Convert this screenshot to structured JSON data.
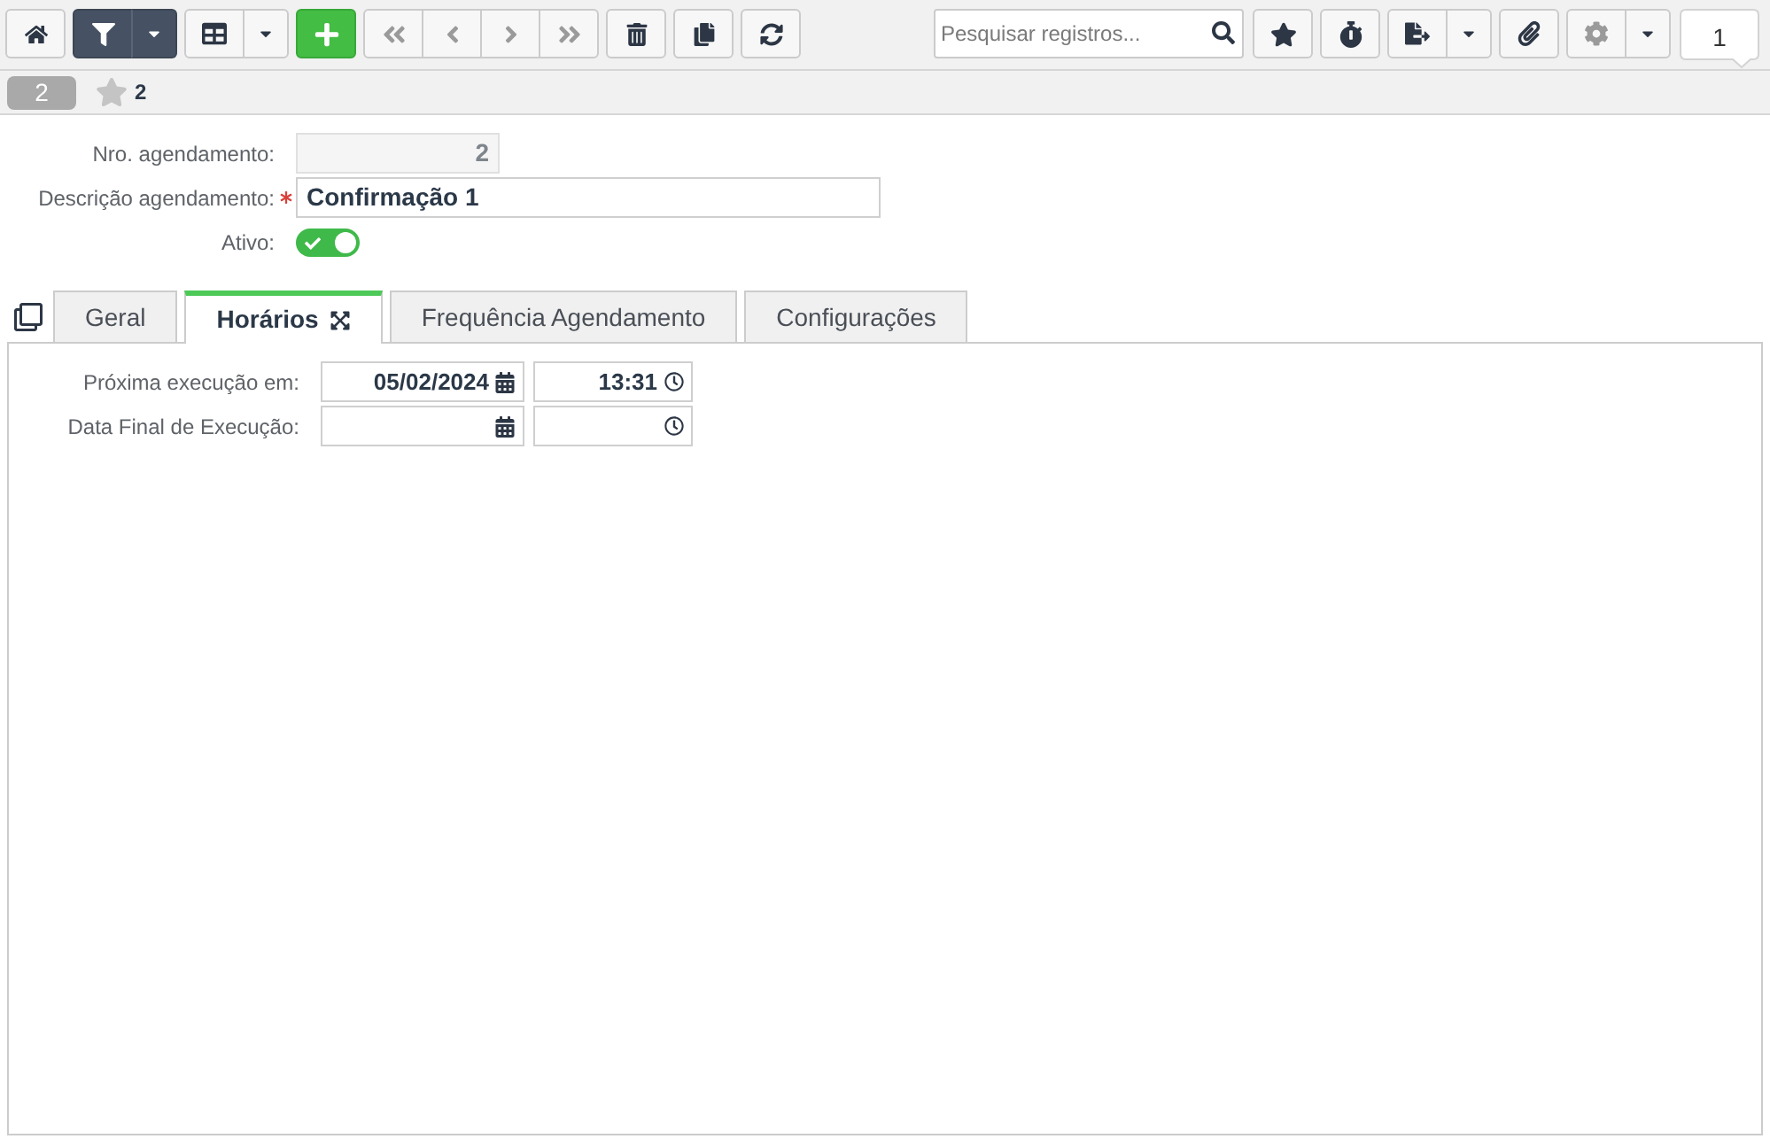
{
  "toolbar": {
    "left": [
      [
        {
          "kind": "home",
          "active": false,
          "disabled": false,
          "dropdown": false
        }
      ],
      [
        {
          "kind": "filter",
          "active": true,
          "disabled": false,
          "dropdown": true
        }
      ],
      [
        {
          "kind": "grid",
          "active": false,
          "disabled": false,
          "dropdown": true
        }
      ],
      [
        {
          "kind": "add",
          "active": false,
          "disabled": false,
          "dropdown": false
        }
      ],
      [
        {
          "kind": "first",
          "active": false,
          "disabled": true,
          "dropdown": false
        },
        {
          "kind": "prev",
          "active": false,
          "disabled": true,
          "dropdown": false
        },
        {
          "kind": "next",
          "active": false,
          "disabled": true,
          "dropdown": false
        },
        {
          "kind": "last",
          "active": false,
          "disabled": true,
          "dropdown": false
        }
      ],
      [
        {
          "kind": "delete",
          "active": false,
          "disabled": false,
          "dropdown": false
        }
      ],
      [
        {
          "kind": "copy",
          "active": false,
          "disabled": false,
          "dropdown": false
        }
      ],
      [
        {
          "kind": "refresh",
          "active": false,
          "disabled": false,
          "dropdown": false
        }
      ]
    ],
    "search": {
      "placeholder": "Pesquisar registros..."
    },
    "right": [
      [
        {
          "kind": "favorite",
          "active": false,
          "disabled": false,
          "dropdown": false
        }
      ],
      [
        {
          "kind": "timer",
          "active": false,
          "disabled": false,
          "dropdown": false
        }
      ],
      [
        {
          "kind": "export",
          "active": false,
          "disabled": false,
          "dropdown": true
        }
      ],
      [
        {
          "kind": "attach",
          "active": false,
          "disabled": false,
          "dropdown": false
        }
      ],
      [
        {
          "kind": "settings",
          "active": false,
          "disabled": true,
          "dropdown": true
        }
      ]
    ],
    "page": "1"
  },
  "record": {
    "badge": "2",
    "favorite": false,
    "title": "2"
  },
  "fields": [
    {
      "kind": "number",
      "label": "Nro. agendamento:",
      "value": "2",
      "disabled": true,
      "required": false
    },
    {
      "kind": "text",
      "label": "Descrição agendamento:",
      "value": "Confirmação 1",
      "disabled": false,
      "required": true
    },
    {
      "kind": "toggle",
      "label": "Ativo:",
      "on": true
    }
  ],
  "tabs": [
    {
      "label": "Geral",
      "selected": false
    },
    {
      "label": "Horários",
      "selected": true
    },
    {
      "label": "Frequência Agendamento",
      "selected": false
    },
    {
      "label": "Configurações",
      "selected": false
    }
  ],
  "schedule": [
    {
      "label": "Próxima execução em:",
      "date": "05/02/2024",
      "time": "13:31"
    },
    {
      "label": "Data Final de Execução:"
    }
  ]
}
